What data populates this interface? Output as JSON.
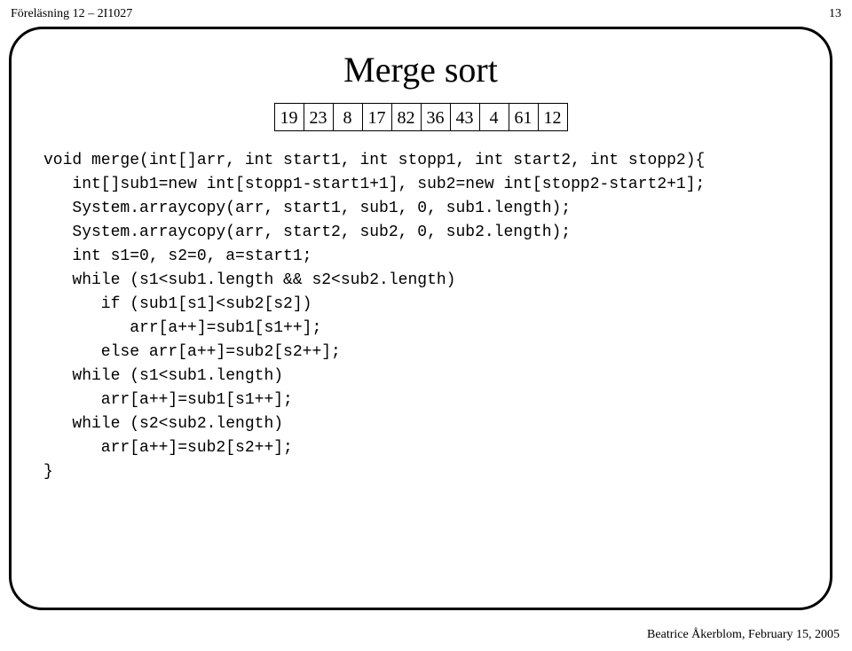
{
  "header": {
    "left": "Föreläsning 12 – 2I1027",
    "right": "13"
  },
  "title": "Merge sort",
  "numbers": [
    "19",
    "23",
    "8",
    "17",
    "82",
    "36",
    "43",
    "4",
    "61",
    "12"
  ],
  "code": {
    "l1": "void merge(int[]arr, int start1, int stopp1, int start2, int stopp2){",
    "l2": "   int[]sub1=new int[stopp1-start1+1], sub2=new int[stopp2-start2+1];",
    "l3": "   System.arraycopy(arr, start1, sub1, 0, sub1.length);",
    "l4": "   System.arraycopy(arr, start2, sub2, 0, sub2.length);",
    "l5": "   int s1=0, s2=0, a=start1;",
    "l6": "   while (s1<sub1.length && s2<sub2.length)",
    "l7": "      if (sub1[s1]<sub2[s2])",
    "l8": "         arr[a++]=sub1[s1++];",
    "l9": "      else arr[a++]=sub2[s2++];",
    "l10": "   while (s1<sub1.length)",
    "l11": "      arr[a++]=sub1[s1++];",
    "l12": "   while (s2<sub2.length)",
    "l13": "      arr[a++]=sub2[s2++];",
    "l14": "}"
  },
  "footer": "Beatrice Åkerblom, February 15, 2005"
}
